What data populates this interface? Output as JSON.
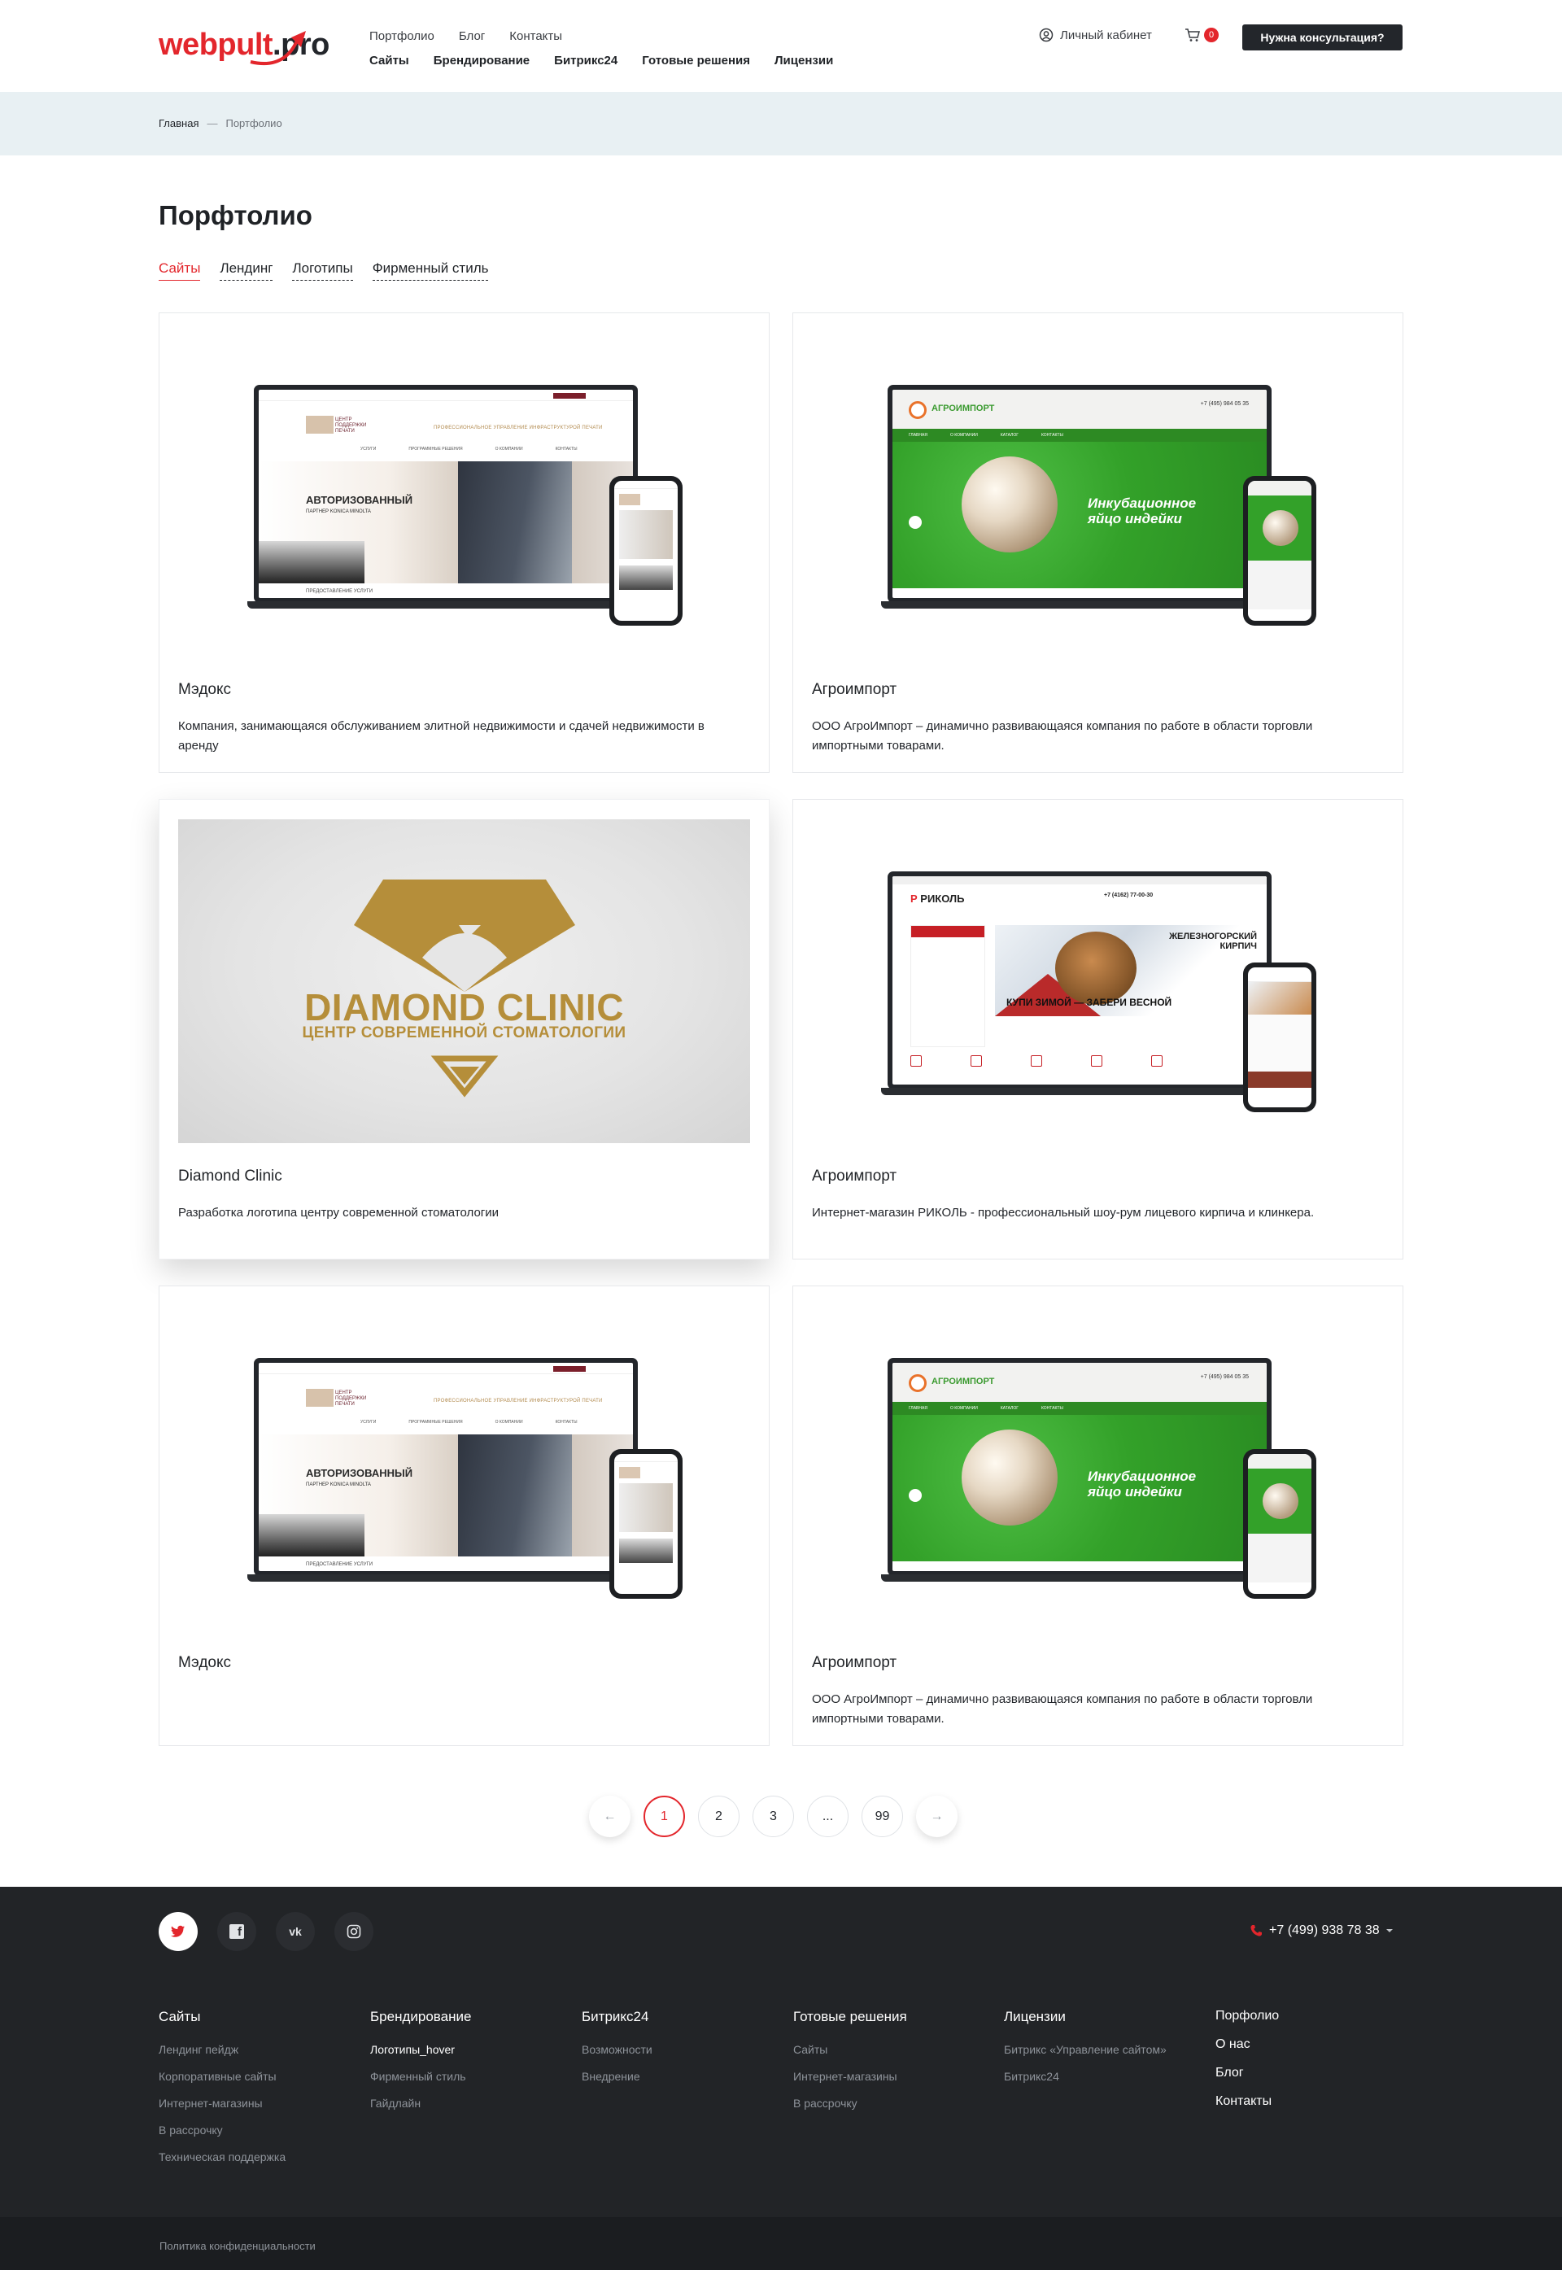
{
  "header": {
    "logo": {
      "part1": "webpult",
      "part2": ".pro"
    },
    "top_links": [
      "Портфолио",
      "Блог",
      "Контакты"
    ],
    "main_links": [
      "Сайты",
      "Брендирование",
      "Битрикс24",
      "Готовые решения",
      "Лицензии"
    ],
    "cabinet": "Личный кабинет",
    "cart_count": "0",
    "consult_button": "Нужна консультация?"
  },
  "breadcrumbs": {
    "home": "Главная",
    "separator": "—",
    "current": "Портфолио"
  },
  "page_title": "Порфтолио",
  "filters": [
    "Сайты",
    "Лендинг",
    "Логотипы",
    "Фирменный стиль"
  ],
  "cards": [
    {
      "title": "Мэдокс",
      "desc": "Компания, занимающаяся обслуживанием элитной недвижимости и сдачей недвижимости в аренду"
    },
    {
      "title": "Агроимпорт",
      "desc": "ООО АгроИмпорт – динамично развивающаяся компания по работе в области торговли импортными товарами."
    },
    {
      "title": "Diamond Clinic",
      "desc": "Разработка логотипа центру современной стоматологии"
    },
    {
      "title": "Агроимпорт",
      "desc": "Интернет-магазин РИКОЛЬ - профессиональный шоу-рум лицевого кирпича и клинкера."
    },
    {
      "title": "Мэдокс",
      "desc": ""
    },
    {
      "title": "Агроимпорт",
      "desc": "ООО АгроИмпорт – динамично развивающаяся компания по работе в области торговли импортными товарами."
    }
  ],
  "mockups": {
    "medoks": {
      "logo": "ЦЕНТР ПОДДЕРЖКИ ПЕЧАТИ",
      "headline": "ПРОФЕССИОНАЛЬНОЕ УПРАВЛЕНИЕ ИНФРАСТРУКТУРОЙ ПЕЧАТИ",
      "nav": [
        "УСЛУГИ",
        "ПРОГРАММНЫЕ РЕШЕНИЯ",
        "О КОМПАНИИ",
        "КОНТАКТЫ"
      ],
      "hero": "АВТОРИЗОВАННЫЙ",
      "partner": "ПАРТНЕР KONICA MINOLTA",
      "footer": "ПРЕДОСТАВЛЕНИЕ УСЛУГИ"
    },
    "agro": {
      "logo": "АГРОИМПОРТ",
      "phone": "+7 (495) 984 05 35",
      "nav": [
        "ГЛАВНАЯ",
        "О КОМПАНИИ",
        "КАТАЛОГ",
        "КОНТАКТЫ"
      ],
      "slogan": "Инкубационное яйцо индейки"
    },
    "rikol": {
      "logo_r": "Р",
      "logo": "РИКОЛЬ",
      "phone": "+7 (4162) 77-00-30",
      "headline": "ЖЕЛЕЗНОГОРСКИЙ КИРПИЧ",
      "buy": "КУПИ ЗИМОЙ — ЗАБЕРИ ВЕСНОЙ"
    },
    "diamond": {
      "name": "DIAMOND CLINIC",
      "sub": "ЦЕНТР СОВРЕМЕННОЙ СТОМАТОЛОГИИ"
    }
  },
  "pagination": {
    "prev": "←",
    "pages": [
      "1",
      "2",
      "3",
      "...",
      "99"
    ],
    "next": "→"
  },
  "footer": {
    "social": [
      {
        "icon": "twitter-icon"
      },
      {
        "icon": "facebook-icon",
        "label": "f"
      },
      {
        "icon": "vk-icon",
        "label": "vk"
      },
      {
        "icon": "instagram-icon"
      }
    ],
    "phone": "+7 (499) 938 78 38",
    "columns": [
      {
        "title": "Сайты",
        "items": [
          "Лендинг пейдж",
          "Корпоративные сайты",
          "Интернет-магазины",
          "В рассрочку",
          "Техническая поддержка"
        ]
      },
      {
        "title": "Брендирование",
        "items": [
          "Логотипы_hover",
          "Фирменный стиль",
          "Гайдлайн"
        ]
      },
      {
        "title": "Битрикс24",
        "items": [
          "Возможности",
          "Внедрение"
        ]
      },
      {
        "title": "Готовые решения",
        "items": [
          "Сайты",
          "Интернет-магазины",
          "В рассрочку"
        ]
      },
      {
        "title": "Лицензии",
        "items": [
          "Битрикс «Управление сайтом»",
          "Битрикс24"
        ]
      }
    ],
    "extra_links": [
      "Порфолио",
      "О нас",
      "Блог",
      "Контакты"
    ],
    "privacy": "Политика конфиденциальности"
  },
  "colors": {
    "accent": "#e3262c",
    "dark": "#23262b",
    "footer_bg": "#222427",
    "crumbs_bg": "#e8f0f3",
    "agro_green": "#33a129",
    "gold": "#b58e3a"
  }
}
